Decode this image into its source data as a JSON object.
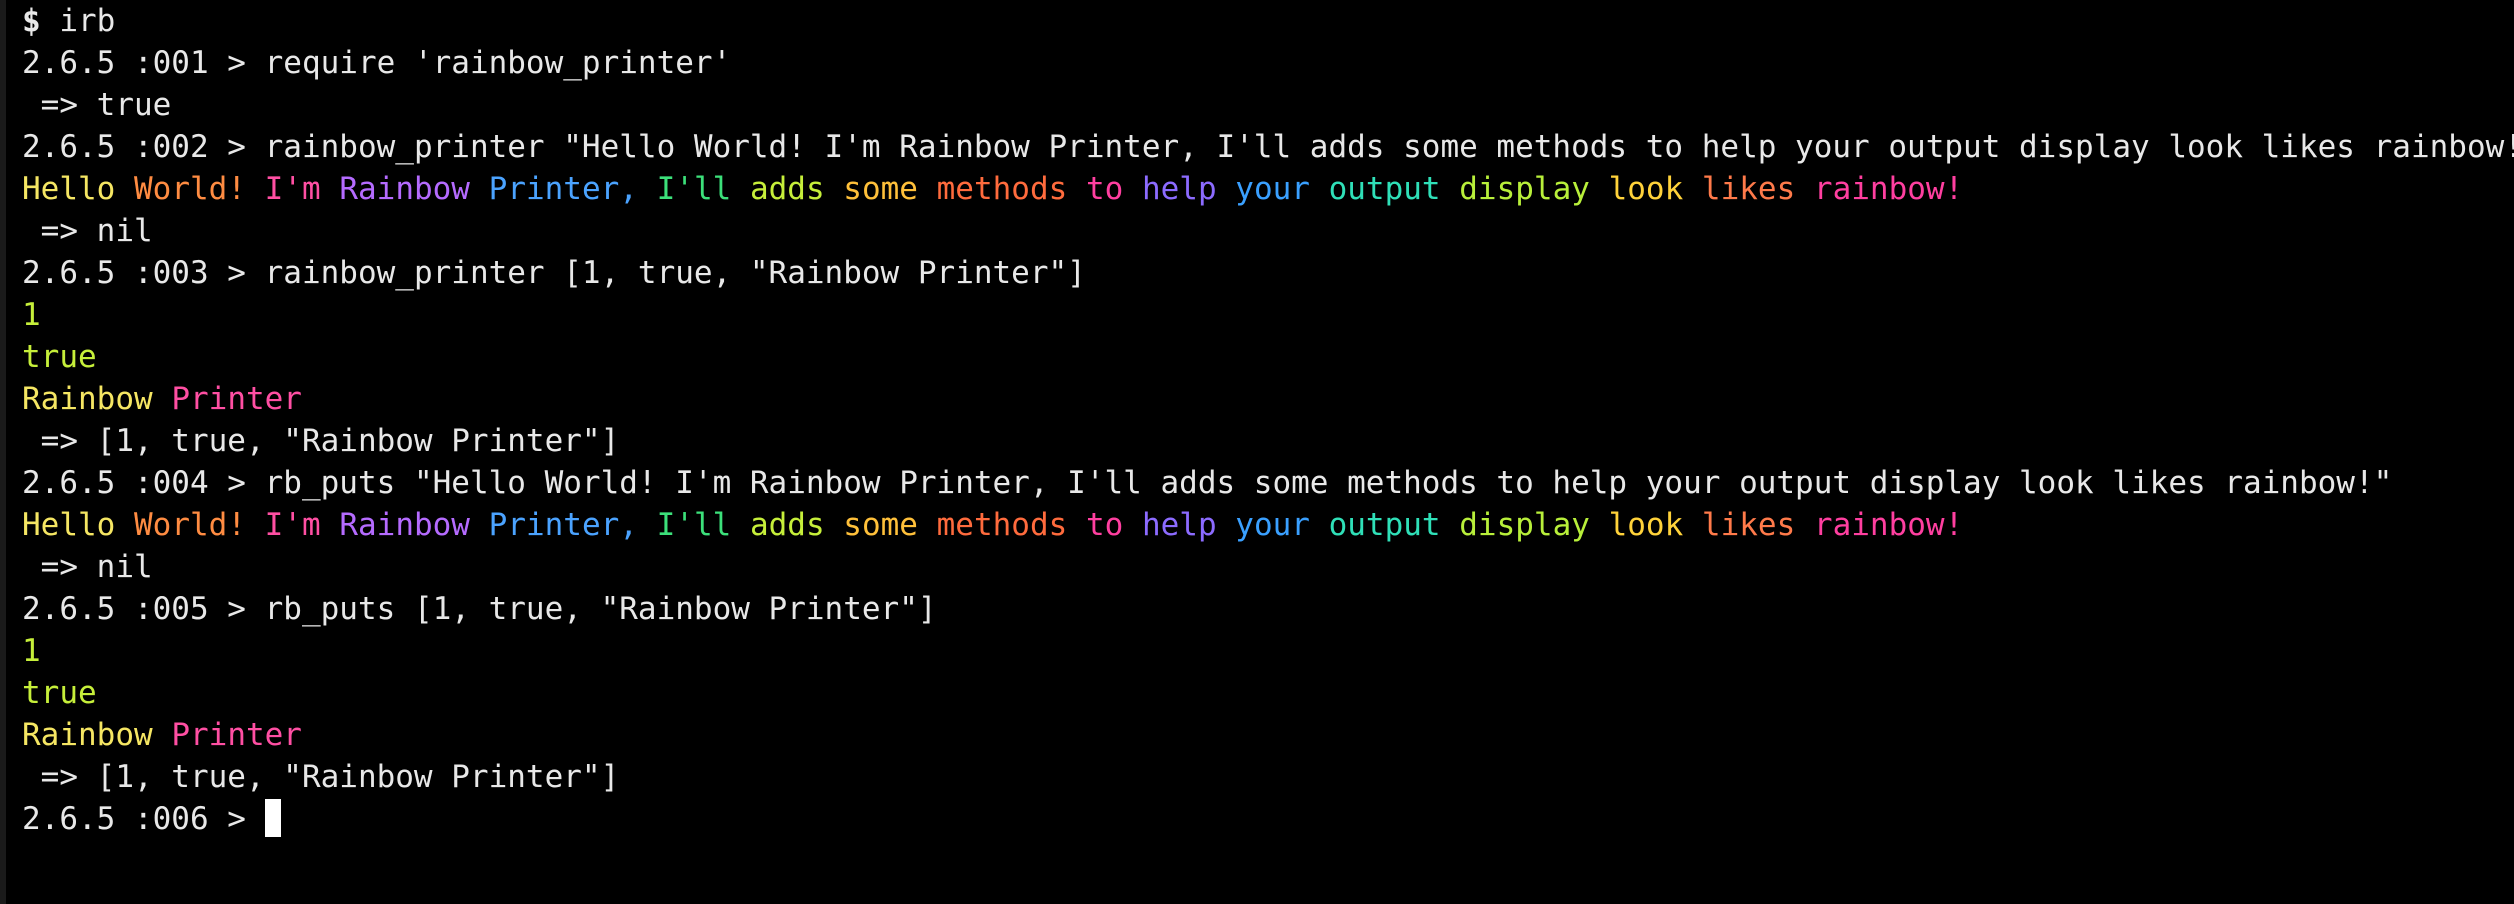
{
  "terminal": {
    "lines": [
      {
        "kind": "shell",
        "prompt": "$",
        "text": " irb"
      },
      {
        "kind": "input",
        "prompt": "2.6.5 :001 > ",
        "text": "require 'rainbow_printer'"
      },
      {
        "kind": "result",
        "text": " => true"
      },
      {
        "kind": "input",
        "prompt": "2.6.5 :002 > ",
        "text": "rainbow_printer \"Hello World! I'm Rainbow Printer, I'll adds some methods to help your output display look likes rainbow!\""
      },
      {
        "kind": "rainbow",
        "words": [
          {
            "text": "Hello",
            "color": "#f5e663"
          },
          {
            "text": "World!",
            "color": "#ff8c42"
          },
          {
            "text": "I'm",
            "color": "#ff4fa3"
          },
          {
            "text": "Rainbow",
            "color": "#b56bff"
          },
          {
            "text": "Printer,",
            "color": "#4ba3ff"
          },
          {
            "text": "I'll",
            "color": "#3ce07a"
          },
          {
            "text": "adds",
            "color": "#c6ef3a"
          },
          {
            "text": "some",
            "color": "#ffc03a"
          },
          {
            "text": "methods",
            "color": "#ff6b3d"
          },
          {
            "text": "to",
            "color": "#ff3fa0"
          },
          {
            "text": "help",
            "color": "#8c6bff"
          },
          {
            "text": "your",
            "color": "#3aa0ff"
          },
          {
            "text": "output",
            "color": "#2fe0b8"
          },
          {
            "text": "display",
            "color": "#b8ef3a"
          },
          {
            "text": "look",
            "color": "#ffd23a"
          },
          {
            "text": "likes",
            "color": "#ff7a4a"
          },
          {
            "text": "rainbow!",
            "color": "#ff3fa0"
          }
        ]
      },
      {
        "kind": "result",
        "text": " => nil"
      },
      {
        "kind": "input",
        "prompt": "2.6.5 :003 > ",
        "text": "rainbow_printer [1, true, \"Rainbow Printer\"]"
      },
      {
        "kind": "rainbow",
        "words": [
          {
            "text": "1",
            "color": "#c6ef3a"
          }
        ]
      },
      {
        "kind": "rainbow",
        "words": [
          {
            "text": "true",
            "color": "#c6ef3a"
          }
        ]
      },
      {
        "kind": "rainbow",
        "words": [
          {
            "text": "Rainbow",
            "color": "#f5e663"
          },
          {
            "text": "Printer",
            "color": "#ff4fa3"
          }
        ]
      },
      {
        "kind": "result",
        "text": " => [1, true, \"Rainbow Printer\"]"
      },
      {
        "kind": "input",
        "prompt": "2.6.5 :004 > ",
        "text": "rb_puts \"Hello World! I'm Rainbow Printer, I'll adds some methods to help your output display look likes rainbow!\""
      },
      {
        "kind": "rainbow",
        "words": [
          {
            "text": "Hello",
            "color": "#f5e663"
          },
          {
            "text": "World!",
            "color": "#ff8c42"
          },
          {
            "text": "I'm",
            "color": "#ff4fa3"
          },
          {
            "text": "Rainbow",
            "color": "#b56bff"
          },
          {
            "text": "Printer,",
            "color": "#4ba3ff"
          },
          {
            "text": "I'll",
            "color": "#3ce07a"
          },
          {
            "text": "adds",
            "color": "#c6ef3a"
          },
          {
            "text": "some",
            "color": "#ffc03a"
          },
          {
            "text": "methods",
            "color": "#ff6b3d"
          },
          {
            "text": "to",
            "color": "#ff3fa0"
          },
          {
            "text": "help",
            "color": "#8c6bff"
          },
          {
            "text": "your",
            "color": "#3aa0ff"
          },
          {
            "text": "output",
            "color": "#2fe0b8"
          },
          {
            "text": "display",
            "color": "#b8ef3a"
          },
          {
            "text": "look",
            "color": "#ffd23a"
          },
          {
            "text": "likes",
            "color": "#ff7a4a"
          },
          {
            "text": "rainbow!",
            "color": "#ff3fa0"
          }
        ]
      },
      {
        "kind": "result",
        "text": " => nil"
      },
      {
        "kind": "input",
        "prompt": "2.6.5 :005 > ",
        "text": "rb_puts [1, true, \"Rainbow Printer\"]"
      },
      {
        "kind": "rainbow",
        "words": [
          {
            "text": "1",
            "color": "#c6ef3a"
          }
        ]
      },
      {
        "kind": "rainbow",
        "words": [
          {
            "text": "true",
            "color": "#c6ef3a"
          }
        ]
      },
      {
        "kind": "rainbow",
        "words": [
          {
            "text": "Rainbow",
            "color": "#f5e663"
          },
          {
            "text": "Printer",
            "color": "#ff4fa3"
          }
        ]
      },
      {
        "kind": "result",
        "text": " => [1, true, \"Rainbow Printer\"]"
      },
      {
        "kind": "prompt",
        "prompt": "2.6.5 :006 > ",
        "text": ""
      }
    ],
    "colors": {
      "background": "#000000",
      "text": "#e8e8e8",
      "cursor": "#ffffff"
    }
  }
}
